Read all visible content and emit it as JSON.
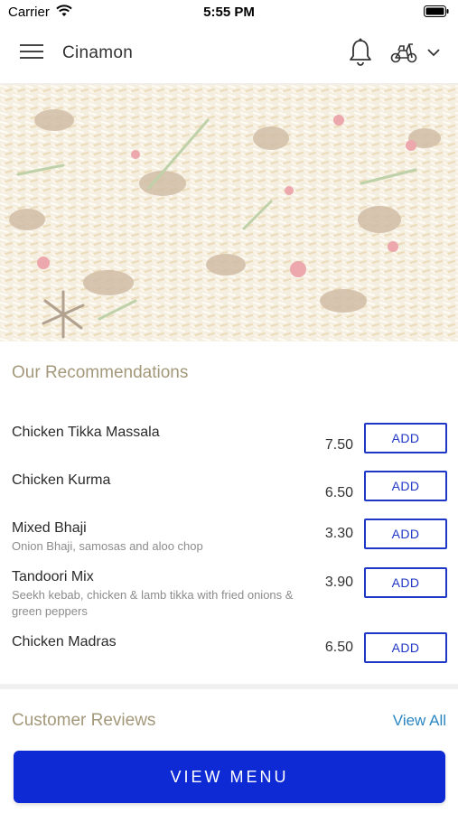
{
  "status_bar": {
    "carrier": "Carrier",
    "time": "5:55 PM"
  },
  "header": {
    "title": "Cinamon",
    "icons": [
      "hamburger-menu-icon",
      "bell-icon",
      "scooter-icon",
      "chevron-down-icon"
    ]
  },
  "hero": {
    "icon": "food-photo"
  },
  "recommendations": {
    "title": "Our Recommendations",
    "items": [
      {
        "name": "Chicken Tikka Massala",
        "description": "",
        "price": "7.50",
        "action": "ADD"
      },
      {
        "name": "Chicken Kurma",
        "description": "",
        "price": "6.50",
        "action": "ADD"
      },
      {
        "name": "Mixed Bhaji",
        "description": "Onion Bhaji, samosas and aloo chop",
        "price": "3.30",
        "action": "ADD"
      },
      {
        "name": "Tandoori Mix",
        "description": "Seekh kebab, chicken & lamb tikka with fried onions & green peppers",
        "price": "3.90",
        "action": "ADD"
      },
      {
        "name": "Chicken Madras",
        "description": "",
        "price": "6.50",
        "action": "ADD"
      }
    ]
  },
  "reviews": {
    "title": "Customer Reviews",
    "view_all": "View All"
  },
  "footer": {
    "view_menu": "VIEW MENU"
  },
  "colors": {
    "accent": "#1f37c7",
    "primary_button": "#0d2ad4",
    "section_title": "#a4987a",
    "link": "#2a86c2"
  }
}
